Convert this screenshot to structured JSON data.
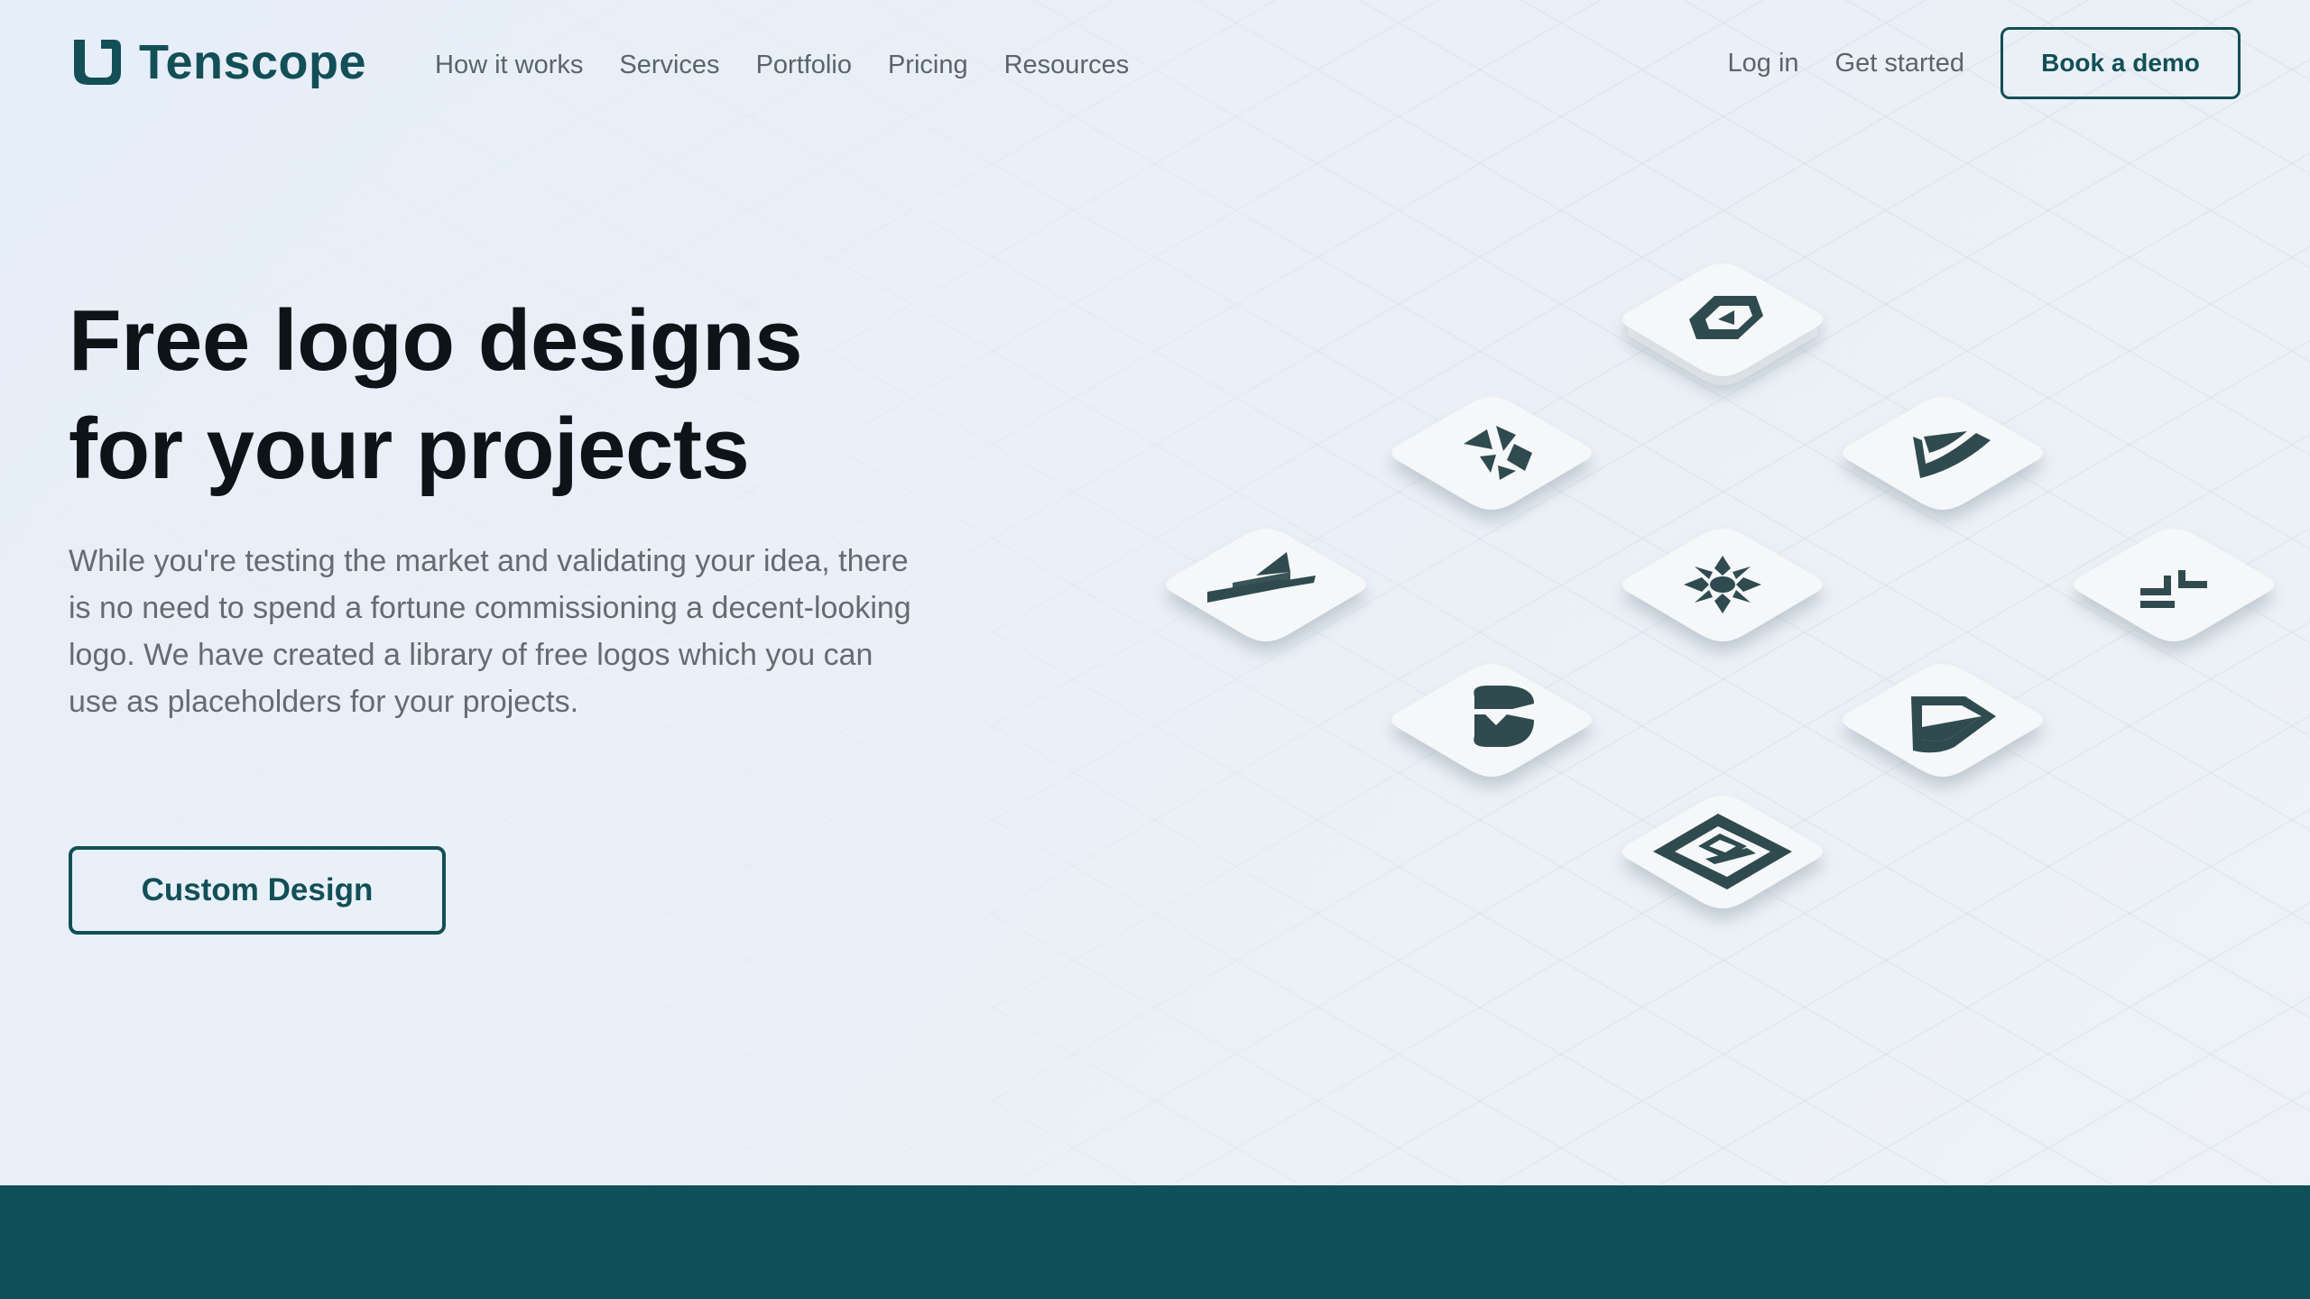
{
  "brand": {
    "name": "Tenscope",
    "icon": "tenscope-logo-icon",
    "color": "#124f57"
  },
  "nav": {
    "items": [
      "How it works",
      "Services",
      "Portfolio",
      "Pricing",
      "Resources"
    ],
    "login": "Log in",
    "get_started": "Get started",
    "demo_button": "Book a demo"
  },
  "hero": {
    "title_line1": "Free logo designs",
    "title_line2": "for your projects",
    "description": "While you're testing the market and validating your idea, there is no need to spend a fortune commissioning a decent-looking logo. We have created a library of free logos which you can use as placeholders for your projects.",
    "cta": "Custom Design"
  },
  "tiles": [
    {
      "icon": "hexagon-chevron-logo-icon"
    },
    {
      "icon": "petal-cluster-logo-icon"
    },
    {
      "icon": "wing-leaf-logo-icon"
    },
    {
      "icon": "stripes-triangle-logo-icon"
    },
    {
      "icon": "flower-logo-icon"
    },
    {
      "icon": "step-blocks-logo-icon"
    },
    {
      "icon": "ribbon-fold-logo-icon"
    },
    {
      "icon": "pentagon-block-logo-icon"
    },
    {
      "icon": "nested-rectangle-logo-icon"
    }
  ],
  "colors": {
    "accent": "#124f57",
    "heading": "#0d1417",
    "body_text": "#646c71",
    "nav_text": "#5b646a",
    "background": "#e8eff8",
    "footer_band": "#0f5059",
    "logo_fill": "#2f4b4f"
  }
}
